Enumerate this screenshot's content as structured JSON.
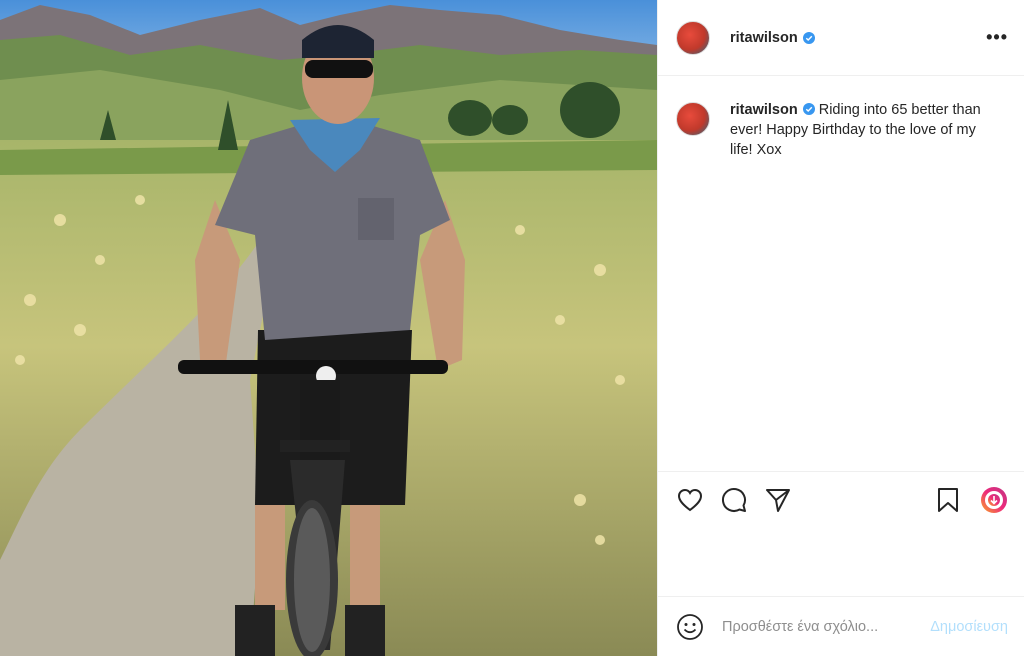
{
  "post": {
    "username": "ritawilson",
    "verified": true,
    "caption": "Riding into 65 better than ever! Happy Birthday to the love of my life! Xox"
  },
  "header": {
    "more_label": "•••"
  },
  "comment": {
    "placeholder": "Προσθέστε ένα σχόλιο...",
    "post_label": "Δημοσίευση"
  },
  "colors": {
    "verified_badge": "#3897f0",
    "post_button_disabled": "#b2dffc",
    "divider": "#efefef"
  },
  "icons": [
    "heart-icon",
    "comment-icon",
    "share-icon",
    "bookmark-icon",
    "reels-badge-icon",
    "emoji-icon",
    "verified-icon",
    "more-icon"
  ]
}
